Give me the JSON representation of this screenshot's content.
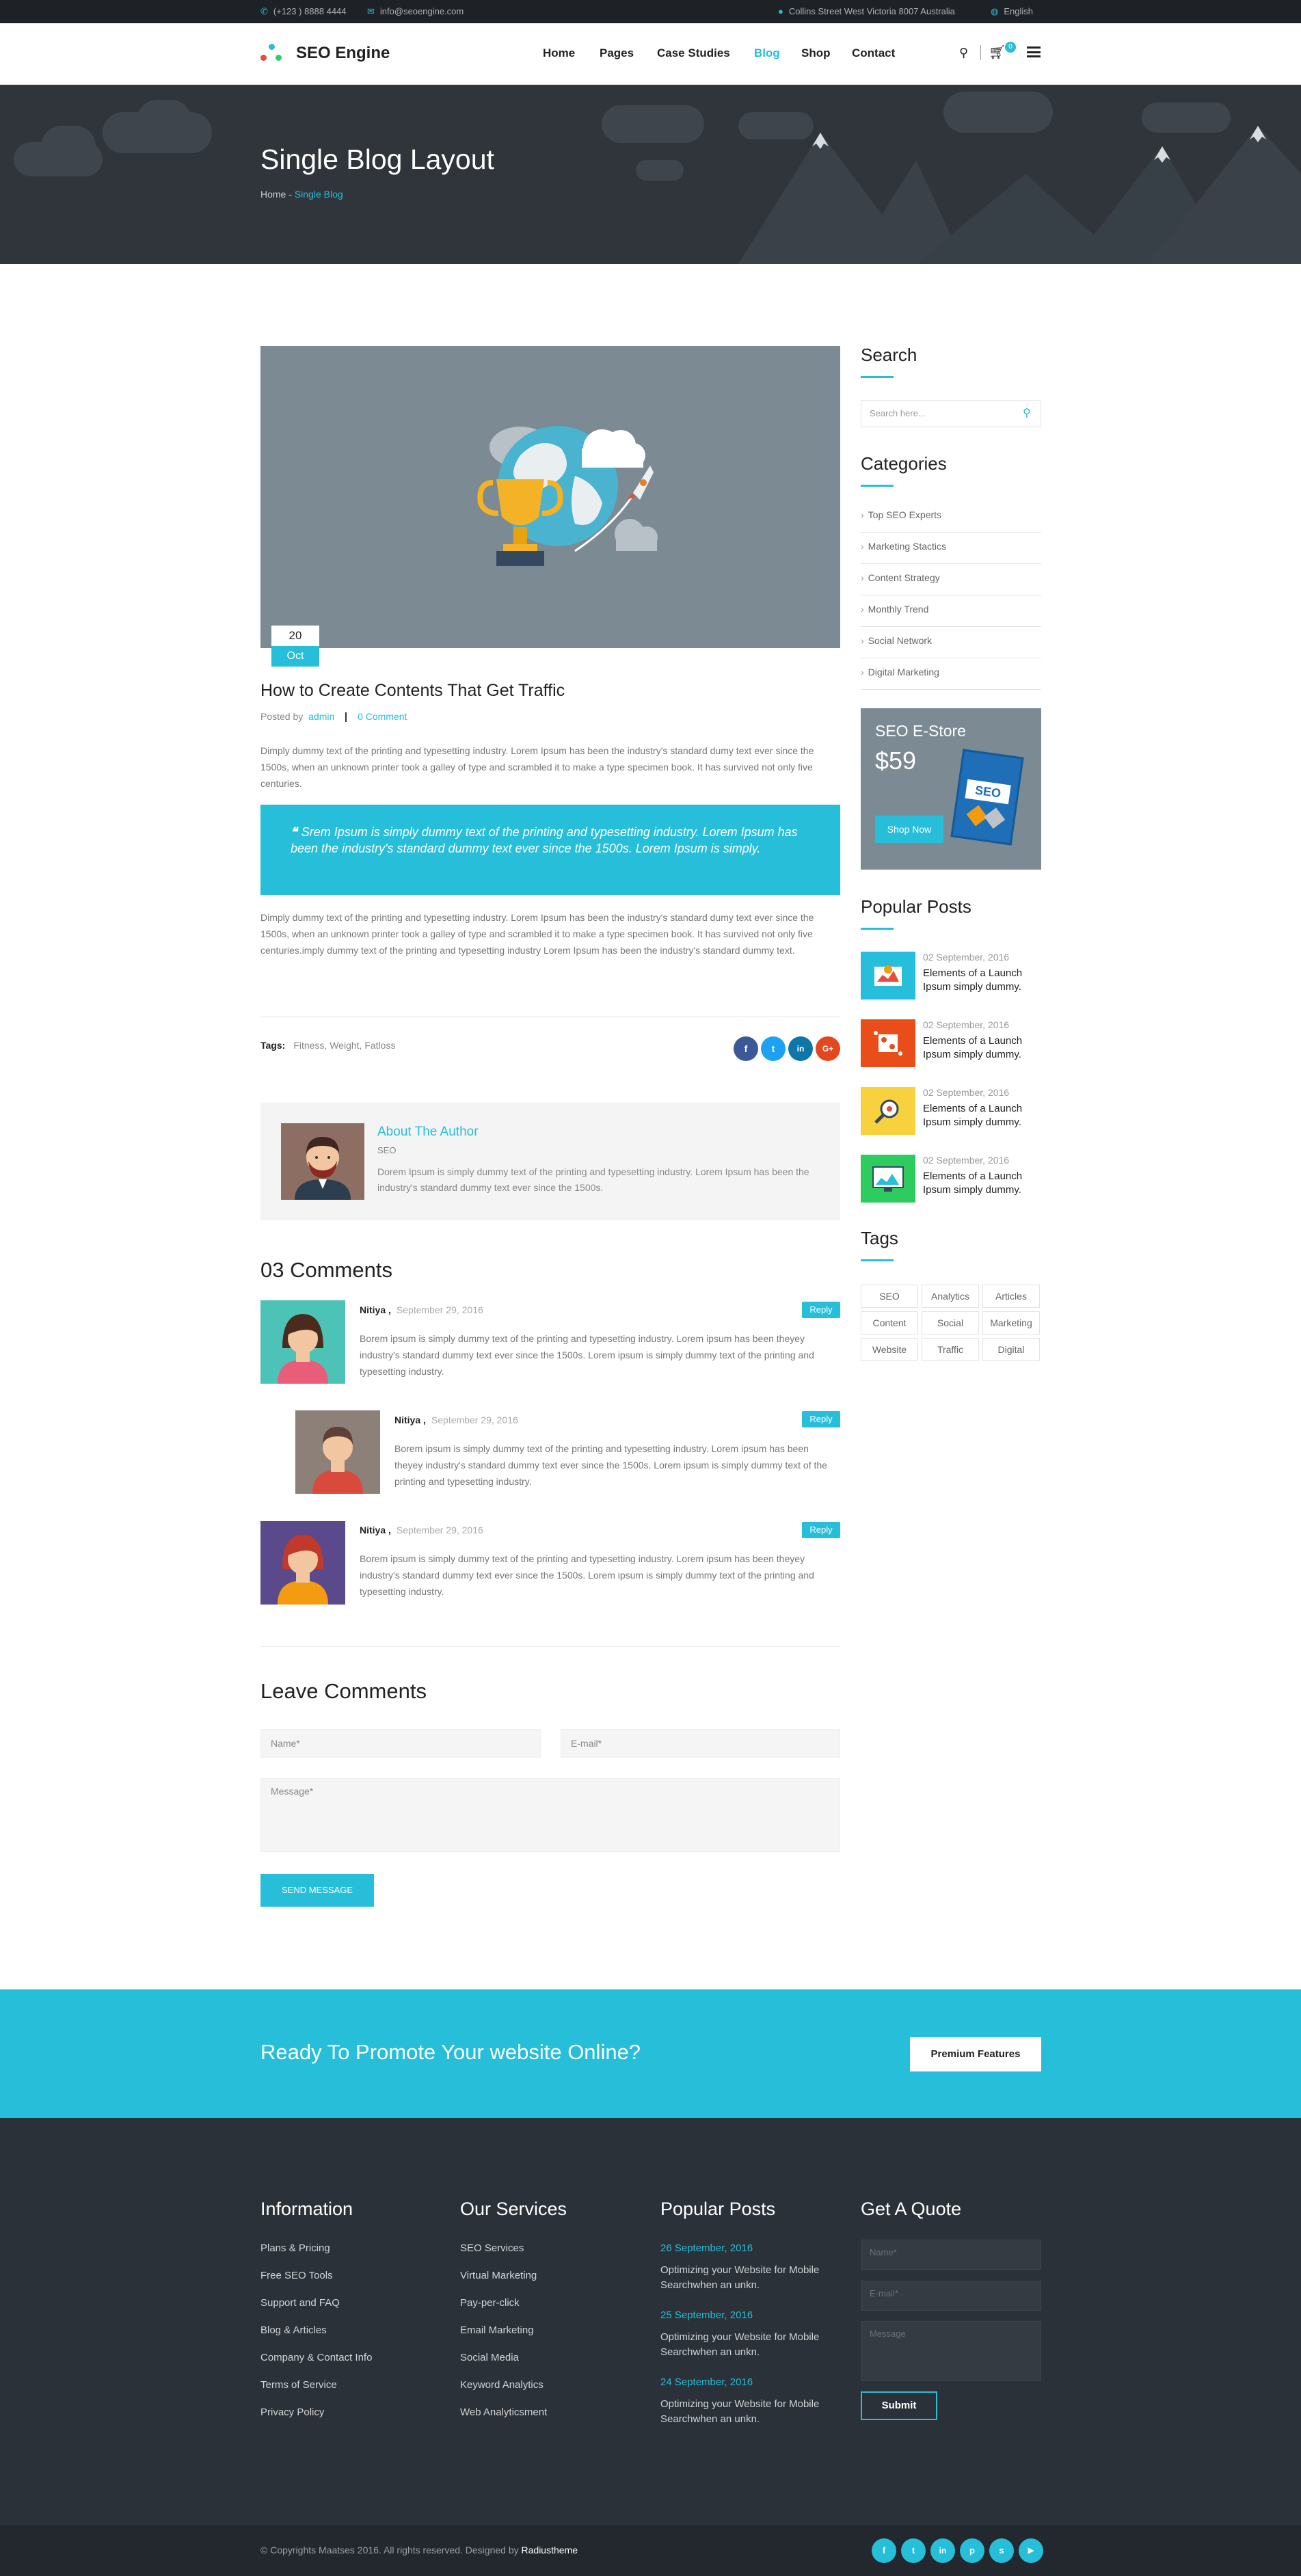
{
  "topbar": {
    "phone": "(+123 ) 8888 4444",
    "email": "info@seoengine.com",
    "address": "Collins Street West Victoria 8007 Australia",
    "language": "English"
  },
  "brand": {
    "name": "SEO Engine"
  },
  "nav": [
    "Home",
    "Pages",
    "Case Studies",
    "Blog",
    "Shop",
    "Contact"
  ],
  "cart_count": "0",
  "hero": {
    "title": "Single Blog Layout",
    "crumb_home": "Home",
    "crumb_sep": " - ",
    "crumb_current": "Single Blog"
  },
  "post": {
    "date_day": "20",
    "date_month": "Oct",
    "title": "How to Create Contents That Get Traffic",
    "posted_by": "Posted by",
    "author": "admin",
    "comments_link": "0 Comment",
    "para1": "Dimply dummy text of the printing and typesetting industry. Lorem Ipsum has been the industry's standard dumy text ever since the 1500s, when an unknown printer took a galley of type and scrambled it to make a type specimen book. It has survived not only five centuries.",
    "quote": "Srem Ipsum is simply dummy text of the printing and typesetting industry. Lorem Ipsum has been the industry's standard dummy text ever since the 1500s. Lorem Ipsum is simply.",
    "para2": "Dimply dummy text of the printing and typesetting industry. Lorem Ipsum has been the industry's standard dumy text ever since the 1500s, when an unknown printer took a galley of type and scrambled it to make a type specimen book. It has survived not only five centuries.imply dummy text of the printing and typesetting industry Lorem Ipsum has been the industry's standard dummy text.",
    "tags_label": "Tags:",
    "tags": "Fitness, Weight, Fatloss",
    "share": [
      "f",
      "t",
      "in",
      "G+"
    ]
  },
  "author_box": {
    "title": "About The Author",
    "role": "SEO",
    "bio": "Dorem Ipsum is simply dummy text of the printing and typesetting industry. Lorem Ipsum has been the industry's standard dummy text ever since the 1500s."
  },
  "comments": {
    "title": "03 Comments",
    "items": [
      {
        "name": "Nitiya ,",
        "date": "September 29, 2016",
        "reply": "Reply",
        "text": "Borem ipsum is simply dummy text of the printing and typesetting industry. Lorem ipsum has been theyey industry's standard dummy text ever since the 1500s. Lorem ipsum is simply dummy text of the printing and typesetting industry."
      },
      {
        "name": "Nitiya ,",
        "date": "September 29, 2016",
        "reply": "Reply",
        "text": "Borem ipsum is simply dummy text of the printing and typesetting industry. Lorem ipsum has been theyey industry's standard dummy text ever since the 1500s. Lorem ipsum is simply dummy text of the printing and typesetting industry."
      },
      {
        "name": "Nitiya ,",
        "date": "September 29, 2016",
        "reply": "Reply",
        "text": "Borem ipsum is simply dummy text of the printing and typesetting industry. Lorem ipsum has been theyey industry's standard dummy text ever since the 1500s. Lorem ipsum is simply dummy text of the printing and typesetting industry."
      }
    ]
  },
  "leave": {
    "title": "Leave Comments",
    "name_ph": "Name*",
    "email_ph": "E-mail*",
    "message_ph": "Message*",
    "send": "SEND MESSAGE"
  },
  "sidebar": {
    "search_title": "Search",
    "search_ph": "Search here...",
    "categories_title": "Categories",
    "categories": [
      "Top SEO Experts",
      "Marketing Stactics",
      "Content Strategy",
      "Monthly Trend",
      "Social Network",
      "Digital Marketing"
    ],
    "store": {
      "title": "SEO E-Store",
      "price": "$59",
      "button": "Shop Now",
      "book": "SEO"
    },
    "popular_title": "Popular Posts",
    "popular": [
      {
        "date": "02 September, 2016",
        "title": "Elements of a Launch Ipsum simply dummy."
      },
      {
        "date": "02 September, 2016",
        "title": "Elements of a Launch Ipsum simply dummy."
      },
      {
        "date": "02 September, 2016",
        "title": "Elements of a Launch Ipsum simply dummy."
      },
      {
        "date": "02 September, 2016",
        "title": "Elements of a Launch Ipsum simply dummy."
      }
    ],
    "tags_title": "Tags",
    "tags": [
      "SEO",
      "Analytics",
      "Articles",
      "Content",
      "Social",
      "Marketing",
      "Website",
      "Traffic",
      "Digital"
    ]
  },
  "cta": {
    "text": "Ready To Promote Your website Online?",
    "button": "Premium Features"
  },
  "footer": {
    "info_title": "Information",
    "info": [
      "Plans & Pricing",
      "Free SEO Tools",
      "Support and FAQ",
      "Blog & Articles",
      "Company & Contact Info",
      "Terms of Service",
      "Privacy Policy"
    ],
    "services_title": "Our Services",
    "services": [
      "SEO Services",
      "Virtual Marketing",
      "Pay-per-click",
      "Email Marketing",
      "Social Media",
      "Keyword Analytics",
      "Web Analyticsment"
    ],
    "popular_title": "Popular Posts",
    "popular": [
      {
        "date": "26 September, 2016",
        "text": "Optimizing your Website for Mobile Searchwhen an unkn."
      },
      {
        "date": "25 September, 2016",
        "text": "Optimizing your Website for Mobile Searchwhen an unkn."
      },
      {
        "date": "24 September, 2016",
        "text": "Optimizing your Website for Mobile Searchwhen an unkn."
      }
    ],
    "quote_title": "Get A Quote",
    "quote_name": "Name*",
    "quote_email": "E-mail*",
    "quote_message": "Message",
    "quote_submit": "Submit",
    "copyright": "© Copyrights Maatses 2016. All rights reserved. Designed by",
    "designer": "Radiustheme",
    "social": [
      "f",
      "t",
      "in",
      "p",
      "s",
      "▶"
    ]
  },
  "colors": {
    "accent": "#26bed9",
    "dark": "#2b3138",
    "footer": "#2b3138"
  }
}
